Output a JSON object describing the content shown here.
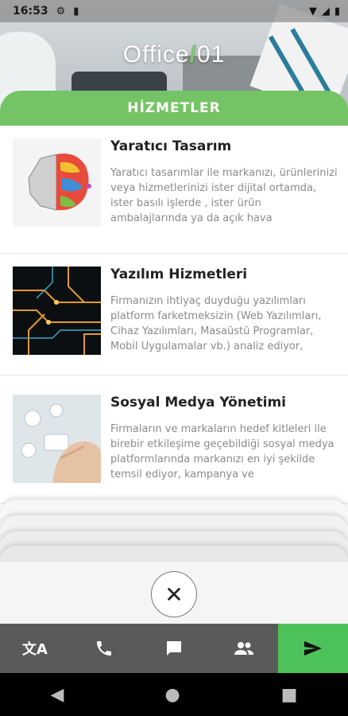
{
  "status": {
    "time": "16:53",
    "gear_icon": "gear-icon",
    "sim_icon": "sim-card-icon"
  },
  "logo": {
    "part1": "Office",
    "slash": "/",
    "part2": "01"
  },
  "header": {
    "title": "HİZMETLER"
  },
  "services": [
    {
      "title": "Yaratıcı Tasarım",
      "desc": "Yaratıcı tasarımlar ile markanızı, ürünlerinizi veya hizmetlerinizi ister dijital ortamda, ister basılı işlerde , ister ürün ambalajlarında ya da açık hava",
      "image": "brain-illustration"
    },
    {
      "title": "Yazılım Hizmetleri",
      "desc": "Firmanızın ihtiyaç duyduğu yazılımları platform farketmeksizin (Web Yazılımları, Cihaz Yazılımları, Masaüstü Programlar, Mobil Uygulamalar vb.) analiz ediyor,",
      "image": "circuit-board"
    },
    {
      "title": "Sosyal Medya Yönetimi",
      "desc": "Firmaların ve markaların hedef kitleleri ile birebir etkileşime geçebildiği sosyal medya platformlarında markanızı en iyi şekilde temsil ediyor, kampanya ve",
      "image": "social-media-hand"
    }
  ],
  "close": {
    "glyph": "✕"
  },
  "bottom_nav": [
    {
      "icon": "translate-icon",
      "glyph": "文A"
    },
    {
      "icon": "phone-icon",
      "glyph": "📞"
    },
    {
      "icon": "chat-icon",
      "glyph": "💬"
    },
    {
      "icon": "people-icon",
      "glyph": "👥"
    },
    {
      "icon": "send-icon",
      "glyph": "➤"
    }
  ],
  "android_nav": {
    "back": "◀",
    "home": "●",
    "recents": "■"
  }
}
